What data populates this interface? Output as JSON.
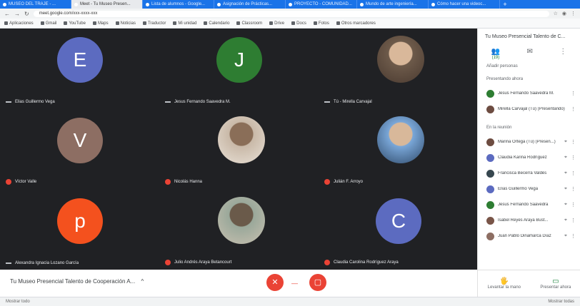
{
  "browser": {
    "tabs": [
      {
        "label": "MUSEO DEL TRAJE - ..."
      },
      {
        "label": "Meet - Tu Museo Presen...",
        "active": true
      },
      {
        "label": "Lista de alumnos - Google..."
      },
      {
        "label": "Asignación de Prácticas..."
      },
      {
        "label": "PROYECTO - COMUNIDAD..."
      },
      {
        "label": "Mundo de arte ingeniería..."
      },
      {
        "label": "Cómo hacer una videoc..."
      }
    ],
    "url": "meet.google.com/xxx-xxxx-xxx",
    "bookmarks": [
      "Aplicaciones",
      "Gmail",
      "YouTube",
      "Maps",
      "Noticias",
      "Traductor",
      "Mi unidad",
      "Calendario",
      "Classroom",
      "Drive",
      "Docs",
      "Fotos",
      "Otros marcadores"
    ]
  },
  "grid": {
    "tiles": [
      {
        "kind": "avatar",
        "letter": "E",
        "color": "#5c6bc0",
        "name": "Elias Guillermo Vega",
        "mic": "gray"
      },
      {
        "kind": "avatar",
        "letter": "J",
        "color": "#2e7d32",
        "name": "Jesus Fernando Saavedra M.",
        "mic": "gray"
      },
      {
        "kind": "photo",
        "name": "Tú - Mirella Carvajal",
        "mic": "gray"
      },
      {
        "kind": "avatar",
        "letter": "V",
        "color": "#8d6e63",
        "name": "Víctor Valle",
        "mic": "red"
      },
      {
        "kind": "photo",
        "name": "Nicolás Hanna",
        "mic": "red"
      },
      {
        "kind": "photo",
        "name": "Julián F. Arroyo",
        "mic": "red"
      },
      {
        "kind": "avatar",
        "letter": "p",
        "color": "#f4511e",
        "name": "Alexandra Ignacia Lozano García",
        "mic": "gray"
      },
      {
        "kind": "photo",
        "name": "Julio Andrés Araya Betancourt",
        "mic": "red"
      },
      {
        "kind": "avatar",
        "letter": "C",
        "color": "#5c6bc0",
        "name": "Claudia Carolina Rodríguez Araya",
        "mic": "red"
      }
    ]
  },
  "callbar": {
    "meeting_title": "Tu Museo Presencial Talento de Cooperación A...",
    "expand": "^",
    "mic_label": "✕",
    "hangup": "—",
    "cam_label": "▢"
  },
  "panel": {
    "title": "Tu Museo Presencial Talento de C...",
    "tabs": [
      {
        "icon": "👥",
        "label": "(19)",
        "active": true
      },
      {
        "icon": "✉",
        "label": ""
      },
      {
        "icon": "⋮",
        "label": ""
      }
    ],
    "add_people": "Añadir personas",
    "section_present": "Presentando ahora",
    "presenting": [
      {
        "name": "Jesus Fernando Saavedra M.",
        "color": "#2e7d32"
      },
      {
        "name": "Mirella Carvajal (Tú) (Presentando)",
        "color": "#6d4c41"
      }
    ],
    "section_meeting": "En la reunión",
    "participants": [
      {
        "name": "Marina Ortega (Tú) (Presen...)",
        "color": "#6d4c41"
      },
      {
        "name": "Claudia Karina Rodríguez",
        "color": "#5c6bc0"
      },
      {
        "name": "Francisca Becerra Valdés",
        "color": "#37474f"
      },
      {
        "name": "Elías Guillermo Vega",
        "color": "#5c6bc0"
      },
      {
        "name": "Jesus Fernando Saavedra",
        "color": "#2e7d32"
      },
      {
        "name": "Isabel Reyes Araya Bust...",
        "color": "#795548"
      },
      {
        "name": "Juan Pablo Dinamarca Díaz",
        "color": "#8d6e63"
      }
    ],
    "footer": [
      {
        "icon": "🖐",
        "label": "Levantar la mano"
      },
      {
        "icon": "▭",
        "label": "Presentar ahora"
      }
    ]
  },
  "statusbar": {
    "left": "Mostrar todo",
    "right": "Mostrar todas"
  }
}
